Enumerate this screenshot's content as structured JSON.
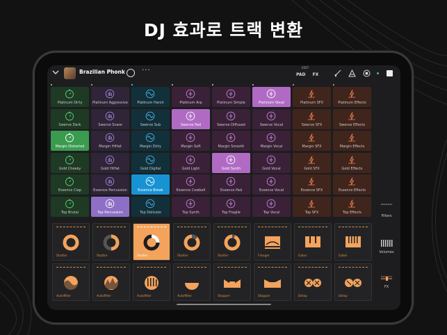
{
  "headline": "DJ 효과로 트랙 변환",
  "topbar": {
    "song_title": "Brazilian Phonk",
    "edit_label": "EDIT",
    "pad_label": "PAD",
    "fx_label": "FX",
    "icons": [
      "chevron-down-icon",
      "album-cover",
      "globe-icon",
      "more-icon",
      "brush-icon",
      "triangle-warning-icon",
      "record-icon",
      "status-dot",
      "stop-icon"
    ]
  },
  "colors": {
    "green": "#1f3a24",
    "green_sel": "#3a9b4f",
    "purple": "#2f2438",
    "purple_sel": "#8d6fc6",
    "blue": "#12303a",
    "blue_sel": "#1793d4",
    "magenta": "#3a2138",
    "magenta_sel": "#b06ac4",
    "orange": "#40251c",
    "fx_accent": "#f3a35c"
  },
  "pad_columns": [
    {
      "theme": "green",
      "icon": "stopwatch-icon",
      "pads": [
        "Platinum Dirty",
        "Swerve Dark",
        "Margin Distorted",
        "Gold Cheeky",
        "Essence Clap",
        "Top Brutal"
      ],
      "selected": 2
    },
    {
      "theme": "purple",
      "icon": "hand-icon",
      "pads": [
        "Platinum Aggressive",
        "Swerve Snare",
        "Margin HiHat",
        "Gold HiHat",
        "Essence Percussion",
        "Top Percussion"
      ],
      "selected": 5
    },
    {
      "theme": "blue",
      "icon": "wave-icon",
      "pads": [
        "Platinum Harsh",
        "Swerve Sub",
        "Margin Dirty",
        "Gold Digital",
        "Essence Break",
        "Top Delicate"
      ],
      "selected": 4
    },
    {
      "theme": "magenta",
      "icon": "sparkle-icon",
      "pads": [
        "Platinum Arp",
        "Swerve Pad",
        "Margin Soft",
        "Gold Light",
        "Essence Cowbell",
        "Top Synth"
      ],
      "selected": 1
    },
    {
      "theme": "magenta",
      "icon": "sparkle-icon",
      "pads": [
        "Platinum Simple",
        "Swerve Diffused",
        "Margin Smooth",
        "Gold Synth",
        "Essence Pad",
        "Top Fragile"
      ],
      "selected": 3
    },
    {
      "theme": "magenta",
      "icon": "sparkle-icon",
      "pads": [
        "Platinum Vocal",
        "Swerve Vocal",
        "Margin Vocal",
        "Gold Vocal",
        "Essence Vocal",
        "Top Vocal"
      ],
      "selected": 0
    },
    {
      "theme": "orange",
      "icon": "flash-icon",
      "pads": [
        "Platinum SFX",
        "Swerve SFX",
        "Margin SFX",
        "Gold SFX",
        "Essence SFX",
        "Top SFX"
      ],
      "selected": -1
    },
    {
      "theme": "orange",
      "icon": "flash-icon",
      "pads": [
        "Platinum Effects",
        "Swerve Effects",
        "Margin Effects",
        "Gold Effects",
        "Essence Effects",
        "Top Effects"
      ],
      "selected": -1
    }
  ],
  "fx_rows": [
    [
      {
        "label": "Stutter",
        "icon": "ring-icon",
        "selected": false
      },
      {
        "label": "Stutter",
        "icon": "ring-half-icon",
        "selected": false
      },
      {
        "label": "Stutter",
        "icon": "ring-quarter-icon",
        "selected": true
      },
      {
        "label": "Stutter",
        "icon": "ring-eighth-icon",
        "selected": false
      },
      {
        "label": "Stutter",
        "icon": "ring-sixteenth-icon",
        "selected": false
      },
      {
        "label": "Flanger",
        "icon": "flanger-icon",
        "selected": false
      },
      {
        "label": "Gater",
        "icon": "gater-icon",
        "selected": false
      },
      {
        "label": "Gater",
        "icon": "gater-fine-icon",
        "selected": false
      }
    ],
    [
      {
        "label": "Autofilter",
        "icon": "autofilter-wave-icon",
        "selected": false
      },
      {
        "label": "Autofilter",
        "icon": "autofilter-peak-icon",
        "selected": false
      },
      {
        "label": "Autofilter",
        "icon": "autofilter-bars-icon",
        "selected": false
      },
      {
        "label": "Autofilter",
        "icon": "autofilter-half-icon",
        "selected": false
      },
      {
        "label": "Stopper",
        "icon": "stopper-icon",
        "selected": false
      },
      {
        "label": "Stopper",
        "icon": "stopper-wide-icon",
        "selected": false
      },
      {
        "label": "Delay",
        "icon": "delay-icon",
        "selected": false
      },
      {
        "label": "Delay",
        "icon": "delay-alt-icon",
        "selected": false
      }
    ]
  ],
  "side_controls": [
    {
      "label": "Filters",
      "icon": "filters-icon"
    },
    {
      "label": "Volumes",
      "icon": "volumes-icon"
    },
    {
      "label": "FX",
      "icon": "fx-slider-icon"
    }
  ]
}
